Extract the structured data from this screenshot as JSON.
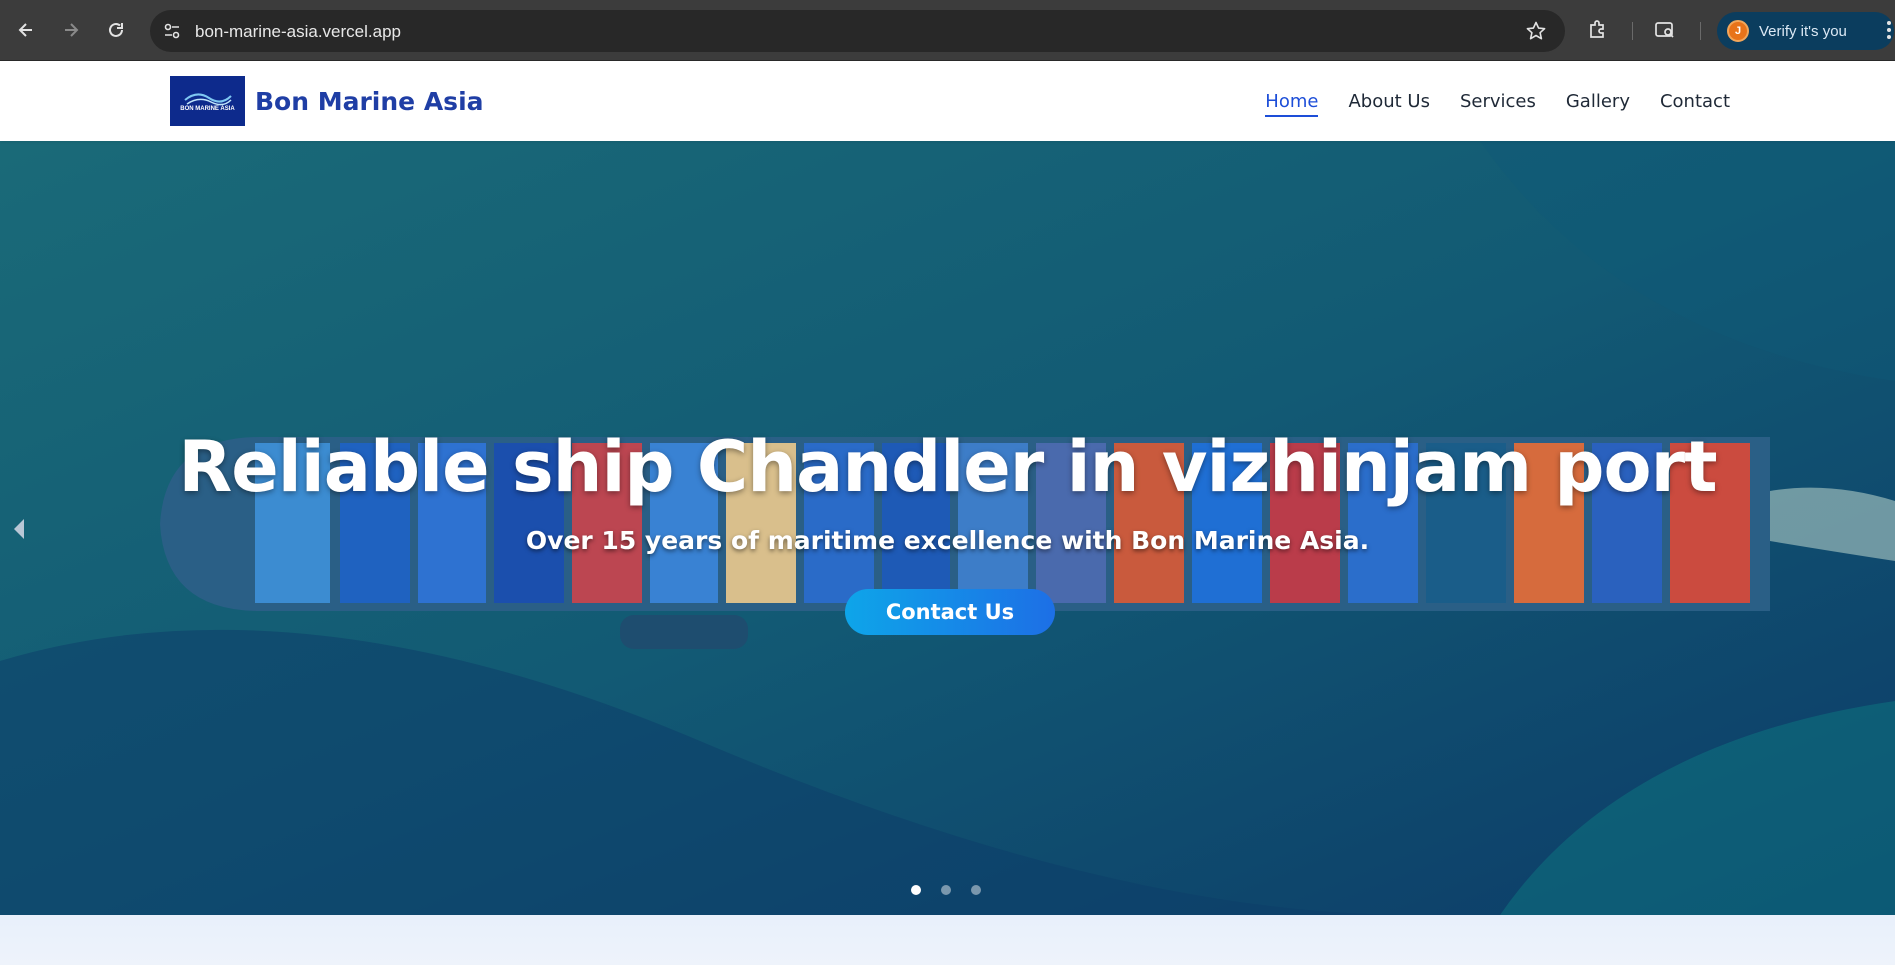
{
  "browser": {
    "url": "bon-marine-asia.vercel.app",
    "verify_label": "Verify it's you",
    "avatar_letter": "J",
    "icons": [
      "back-icon",
      "forward-icon",
      "reload-icon",
      "site-settings-icon",
      "star-icon",
      "extensions-icon",
      "tab-search-icon",
      "more-icon"
    ]
  },
  "header": {
    "brand": "Bon Marine Asia",
    "logo_text": "BON MARINE ASIA",
    "nav": [
      {
        "label": "Home",
        "active": true
      },
      {
        "label": "About Us",
        "active": false
      },
      {
        "label": "Services",
        "active": false
      },
      {
        "label": "Gallery",
        "active": false
      },
      {
        "label": "Contact",
        "active": false
      }
    ]
  },
  "hero": {
    "title": "Reliable ship Chandler in vizhinjam port",
    "subtitle": "Over 15 years of maritime excellence with Bon Marine Asia.",
    "cta_label": "Contact Us",
    "slides_count": 3,
    "active_slide": 1
  },
  "colors": {
    "brand_blue": "#1f3ea5",
    "nav_active": "#1d4ed8",
    "cta_gradient_start": "#0ea5e9",
    "cta_gradient_end": "#1d6fe6"
  }
}
